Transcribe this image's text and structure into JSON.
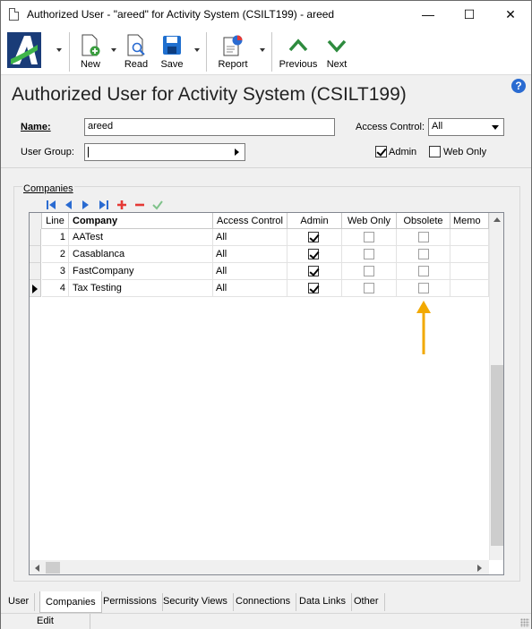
{
  "window": {
    "title": "Authorized User - \"areed\" for Activity System (CSILT199) - areed",
    "minimize_glyph": "—",
    "maximize_glyph": "☐",
    "close_glyph": "✕"
  },
  "toolbar": {
    "new_label": "New",
    "read_label": "Read",
    "save_label": "Save",
    "report_label": "Report",
    "previous_label": "Previous",
    "next_label": "Next"
  },
  "form": {
    "page_title": "Authorized User for Activity System (CSILT199)",
    "name_label": "Name:",
    "name_value": "areed",
    "access_control_label": "Access Control:",
    "access_control_value": "All",
    "user_group_label": "User Group:",
    "user_group_value": "",
    "admin_label": "Admin",
    "admin_checked": true,
    "web_only_label": "Web Only",
    "web_only_checked": false
  },
  "companies": {
    "group_title": "Companies",
    "columns": [
      "Line",
      "Company",
      "Access Control",
      "Admin",
      "Web Only",
      "Obsolete",
      "Memo"
    ],
    "rows": [
      {
        "line": "1",
        "company": "AATest",
        "access_control": "All",
        "admin": true,
        "web_only": false,
        "obsolete": false,
        "memo": ""
      },
      {
        "line": "2",
        "company": "Casablanca",
        "access_control": "All",
        "admin": true,
        "web_only": false,
        "obsolete": false,
        "memo": ""
      },
      {
        "line": "3",
        "company": "FastCompany",
        "access_control": "All",
        "admin": true,
        "web_only": false,
        "obsolete": false,
        "memo": ""
      },
      {
        "line": "4",
        "company": "Tax Testing",
        "access_control": "All",
        "admin": true,
        "web_only": false,
        "obsolete": false,
        "memo": ""
      }
    ]
  },
  "tabs": [
    "User",
    "Companies",
    "Permissions",
    "Security Views",
    "Connections",
    "Data Links",
    "Other"
  ],
  "active_tab": "Companies",
  "status": {
    "mode": "Edit"
  },
  "colors": {
    "accent_blue": "#2a6bd1",
    "nav_green": "#2e8b3e",
    "annotation_arrow": "#f2a900"
  }
}
